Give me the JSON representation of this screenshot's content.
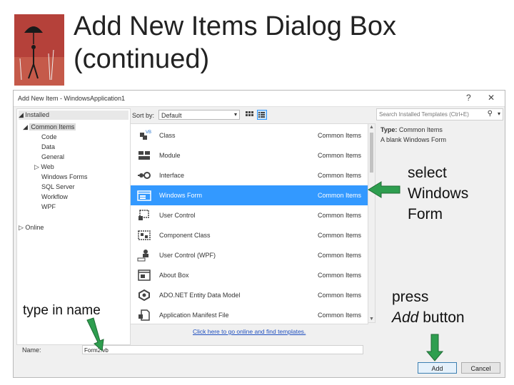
{
  "slide": {
    "title_line1": "Add New Items Dialog Box",
    "title_line2": "(continued)"
  },
  "dialog": {
    "title": "Add New Item - WindowsApplication1",
    "help_glyph": "?",
    "close_glyph": "✕",
    "tree": {
      "installed": "Installed",
      "common_items": "Common Items",
      "children": [
        "Code",
        "Data",
        "General",
        "Web",
        "Windows Forms",
        "SQL Server",
        "Workflow",
        "WPF"
      ],
      "online": "Online"
    },
    "sort": {
      "label": "Sort by:",
      "value": "Default"
    },
    "search_placeholder": "Search Installed Templates (Ctrl+E)",
    "templates": [
      {
        "name": "Class",
        "category": "Common Items",
        "icon": "class-icon"
      },
      {
        "name": "Module",
        "category": "Common Items",
        "icon": "module-icon"
      },
      {
        "name": "Interface",
        "category": "Common Items",
        "icon": "interface-icon"
      },
      {
        "name": "Windows Form",
        "category": "Common Items",
        "icon": "windows-form-icon",
        "selected": true
      },
      {
        "name": "User Control",
        "category": "Common Items",
        "icon": "user-control-icon"
      },
      {
        "name": "Component Class",
        "category": "Common Items",
        "icon": "component-class-icon"
      },
      {
        "name": "User Control (WPF)",
        "category": "Common Items",
        "icon": "wpf-user-control-icon"
      },
      {
        "name": "About Box",
        "category": "Common Items",
        "icon": "about-box-icon"
      },
      {
        "name": "ADO.NET Entity Data Model",
        "category": "Common Items",
        "icon": "entity-model-icon"
      },
      {
        "name": "Application Manifest File",
        "category": "Common Items",
        "icon": "manifest-icon"
      }
    ],
    "details": {
      "type_label": "Type:",
      "type_value": "Common Items",
      "description": "A blank Windows Form"
    },
    "online_link": "Click here to go online and find templates.",
    "name_label": "Name:",
    "name_value": "Form2.vb",
    "add_button": "Add",
    "cancel_button": "Cancel"
  },
  "callouts": {
    "select_line1": "select",
    "select_line2": "Windows",
    "select_line3": "Form",
    "type_in_name": "type in name",
    "press_line1": "press",
    "press_add": "Add",
    "press_button": " button"
  },
  "colors": {
    "selection": "#3399ff",
    "arrow_fill": "#2e9e4f",
    "logo_red": "#b5413a"
  }
}
